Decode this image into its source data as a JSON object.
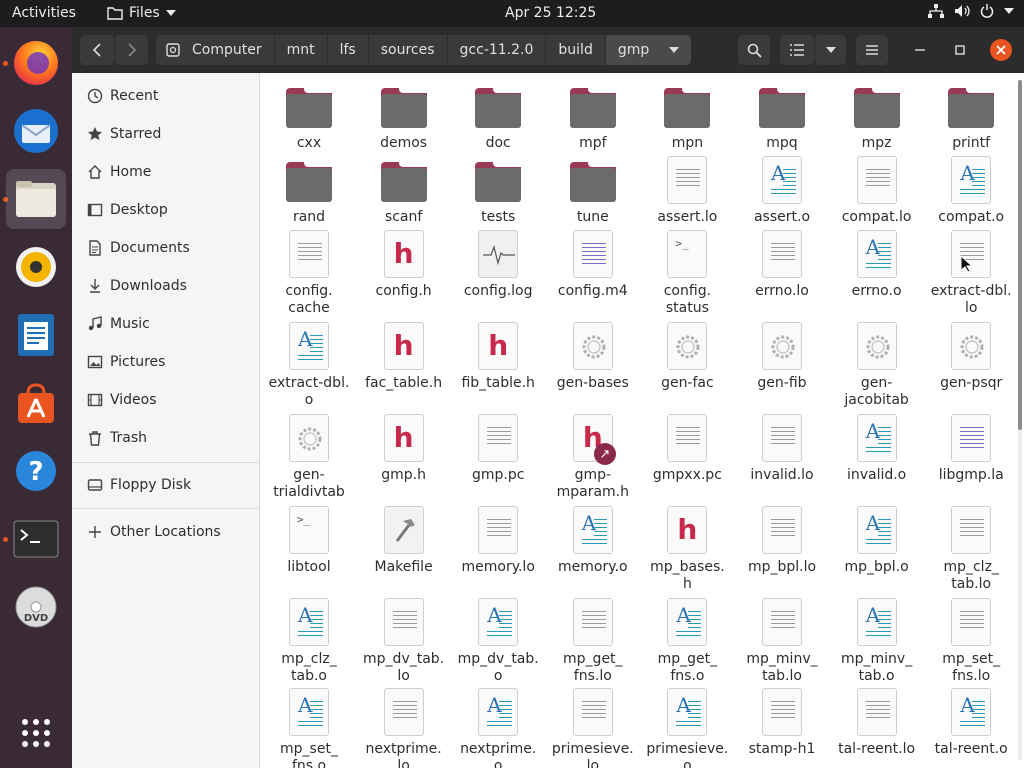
{
  "topbar": {
    "activities": "Activities",
    "app_name": "Files",
    "clock": "Apr 25  12:25"
  },
  "dock": {
    "items": [
      "firefox",
      "thunderbird",
      "files",
      "rhythmbox",
      "libreoffice-writer",
      "app-center",
      "help",
      "terminal",
      "dvd"
    ]
  },
  "headerbar": {
    "breadcrumbs": [
      "Computer",
      "mnt",
      "lfs",
      "sources",
      "gcc-11.2.0",
      "build",
      "gmp"
    ]
  },
  "sidebar": {
    "items": [
      {
        "label": "Recent",
        "icon": "clock-icon"
      },
      {
        "label": "Starred",
        "icon": "star-icon"
      },
      {
        "label": "Home",
        "icon": "home-icon"
      },
      {
        "label": "Desktop",
        "icon": "desktop-icon"
      },
      {
        "label": "Documents",
        "icon": "document-icon"
      },
      {
        "label": "Downloads",
        "icon": "download-icon"
      },
      {
        "label": "Music",
        "icon": "music-icon"
      },
      {
        "label": "Pictures",
        "icon": "picture-icon"
      },
      {
        "label": "Videos",
        "icon": "video-icon"
      },
      {
        "label": "Trash",
        "icon": "trash-icon"
      }
    ],
    "devices": [
      {
        "label": "Floppy Disk",
        "icon": "disk-icon"
      }
    ],
    "other": {
      "label": "Other Locations",
      "icon": "plus-icon"
    }
  },
  "files": [
    {
      "label": "cxx",
      "type": "folder"
    },
    {
      "label": "demos",
      "type": "folder"
    },
    {
      "label": "doc",
      "type": "folder"
    },
    {
      "label": "mpf",
      "type": "folder"
    },
    {
      "label": "mpn",
      "type": "folder"
    },
    {
      "label": "mpq",
      "type": "folder"
    },
    {
      "label": "mpz",
      "type": "folder"
    },
    {
      "label": "printf",
      "type": "folder"
    },
    {
      "label": "rand",
      "type": "folder"
    },
    {
      "label": "scanf",
      "type": "folder"
    },
    {
      "label": "tests",
      "type": "folder"
    },
    {
      "label": "tune",
      "type": "folder"
    },
    {
      "label": "assert.lo",
      "type": "text"
    },
    {
      "label": "assert.o",
      "type": "object"
    },
    {
      "label": "compat.lo",
      "type": "text"
    },
    {
      "label": "compat.o",
      "type": "object"
    },
    {
      "label": "config.\ncache",
      "type": "text"
    },
    {
      "label": "config.h",
      "type": "header"
    },
    {
      "label": "config.log",
      "type": "log"
    },
    {
      "label": "config.m4",
      "type": "code"
    },
    {
      "label": "config.\nstatus",
      "type": "script"
    },
    {
      "label": "errno.lo",
      "type": "text"
    },
    {
      "label": "errno.o",
      "type": "object"
    },
    {
      "label": "extract-dbl.\nlo",
      "type": "text"
    },
    {
      "label": "extract-dbl.\no",
      "type": "object"
    },
    {
      "label": "fac_table.h",
      "type": "header"
    },
    {
      "label": "fib_table.h",
      "type": "header"
    },
    {
      "label": "gen-bases",
      "type": "exec"
    },
    {
      "label": "gen-fac",
      "type": "exec"
    },
    {
      "label": "gen-fib",
      "type": "exec"
    },
    {
      "label": "gen-\njacobitab",
      "type": "exec"
    },
    {
      "label": "gen-psqr",
      "type": "exec"
    },
    {
      "label": "gen-\ntrialdivtab",
      "type": "exec"
    },
    {
      "label": "gmp.h",
      "type": "header"
    },
    {
      "label": "gmp.pc",
      "type": "text"
    },
    {
      "label": "gmp-\nmparam.h",
      "type": "header-link"
    },
    {
      "label": "gmpxx.pc",
      "type": "text"
    },
    {
      "label": "invalid.lo",
      "type": "text"
    },
    {
      "label": "invalid.o",
      "type": "object"
    },
    {
      "label": "libgmp.la",
      "type": "code"
    },
    {
      "label": "libtool",
      "type": "script"
    },
    {
      "label": "Makefile",
      "type": "makefile"
    },
    {
      "label": "memory.lo",
      "type": "text"
    },
    {
      "label": "memory.o",
      "type": "object"
    },
    {
      "label": "mp_bases.\nh",
      "type": "header"
    },
    {
      "label": "mp_bpl.lo",
      "type": "text"
    },
    {
      "label": "mp_bpl.o",
      "type": "object"
    },
    {
      "label": "mp_clz_\ntab.lo",
      "type": "text"
    },
    {
      "label": "mp_clz_\ntab.o",
      "type": "object"
    },
    {
      "label": "mp_dv_tab.\nlo",
      "type": "text"
    },
    {
      "label": "mp_dv_tab.\no",
      "type": "object"
    },
    {
      "label": "mp_get_\nfns.lo",
      "type": "text"
    },
    {
      "label": "mp_get_\nfns.o",
      "type": "object"
    },
    {
      "label": "mp_minv_\ntab.lo",
      "type": "text"
    },
    {
      "label": "mp_minv_\ntab.o",
      "type": "object"
    },
    {
      "label": "mp_set_\nfns.lo",
      "type": "text"
    },
    {
      "label": "mp_set_\nfns.o",
      "type": "object"
    },
    {
      "label": "nextprime.\nlo",
      "type": "text"
    },
    {
      "label": "nextprime.\no",
      "type": "object"
    },
    {
      "label": "primesieve.\nlo",
      "type": "text"
    },
    {
      "label": "primesieve.\no",
      "type": "object"
    },
    {
      "label": "stamp-h1",
      "type": "text"
    },
    {
      "label": "tal-reent.lo",
      "type": "text"
    },
    {
      "label": "tal-reent.o",
      "type": "object"
    }
  ],
  "colors": {
    "folder_tab": "#9b3a56",
    "folder_body": "#6b6b6b",
    "header_letter": "#c8284a",
    "accent": "#e95420"
  }
}
